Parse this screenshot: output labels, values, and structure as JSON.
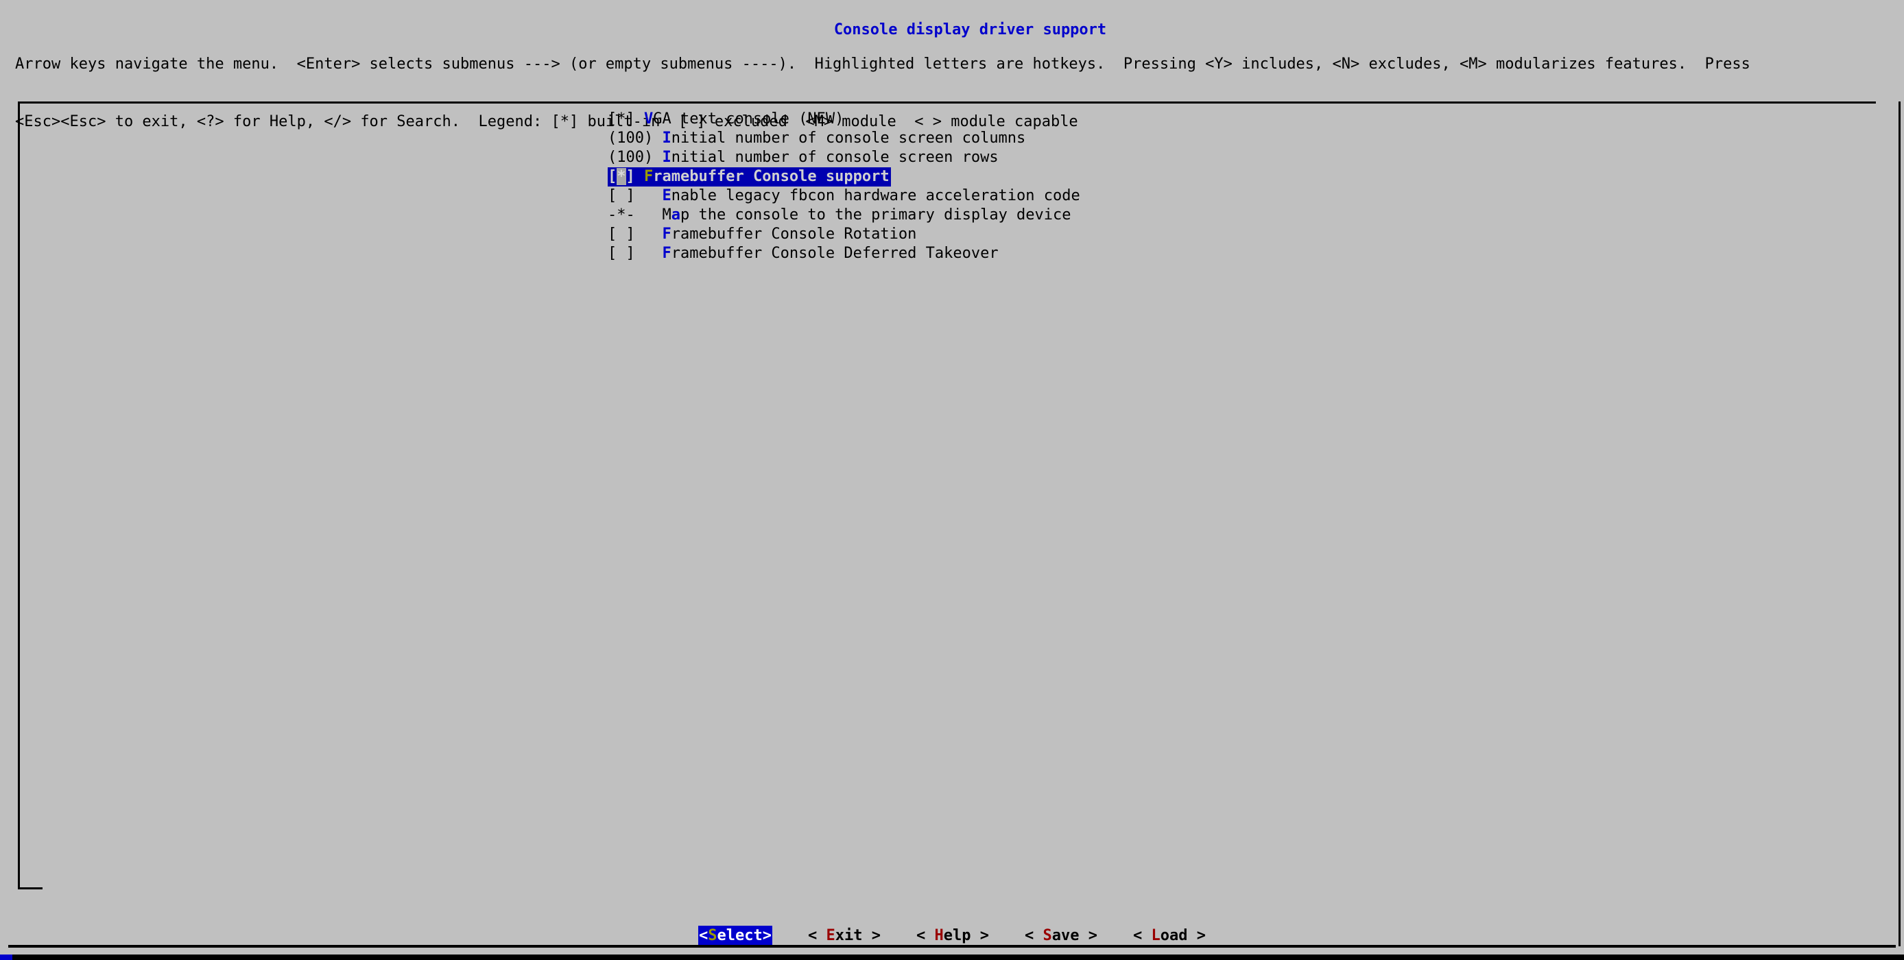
{
  "window": {
    "title": "Console display driver support"
  },
  "help": {
    "line1": "Arrow keys navigate the menu.  <Enter> selects submenus ---> (or empty submenus ----).  Highlighted letters are hotkeys.  Pressing <Y> includes, <N> excludes, <M> modularizes features.  Press",
    "line2": "<Esc><Esc> to exit, <?> for Help, </> for Search.  Legend: [*] built-in  [ ] excluded  <M> module  < > module capable"
  },
  "menu": {
    "items": [
      {
        "flag": "[*] ",
        "indent": "",
        "hotkey": "V",
        "label": "GA text console (NEW)",
        "selected": false
      },
      {
        "flag": "(100) ",
        "indent": "",
        "hotkey": "I",
        "label": "nitial number of console screen columns",
        "selected": false
      },
      {
        "flag": "(100) ",
        "indent": "",
        "hotkey": "I",
        "label": "nitial number of console screen rows",
        "selected": false
      },
      {
        "flag_pre": "[",
        "flag_cursor": "*",
        "flag_post": "] ",
        "flag": "[*] ",
        "indent": "",
        "hotkey": "F",
        "label": "ramebuffer Console support",
        "selected": true
      },
      {
        "flag": "[ ] ",
        "indent": "  ",
        "hotkey": "E",
        "label": "nable legacy fbcon hardware acceleration code",
        "selected": false
      },
      {
        "flag": "-*- ",
        "indent": "  ",
        "prefix": "M",
        "hotkey": "a",
        "label": "p the console to the primary display device",
        "selected": false
      },
      {
        "flag": "[ ] ",
        "indent": "  ",
        "hotkey": "F",
        "label": "ramebuffer Console Rotation",
        "selected": false
      },
      {
        "flag": "[ ] ",
        "indent": "  ",
        "hotkey": "F",
        "label": "ramebuffer Console Deferred Takeover",
        "selected": false
      }
    ]
  },
  "buttons": [
    {
      "open": "<",
      "hotkey": "S",
      "rest": "elect",
      "close": ">",
      "active": true
    },
    {
      "open": "< ",
      "hotkey": "E",
      "rest": "xit",
      "close": " >",
      "active": false
    },
    {
      "open": "< ",
      "hotkey": "H",
      "rest": "elp",
      "close": " >",
      "active": false
    },
    {
      "open": "< ",
      "hotkey": "S",
      "rest": "ave",
      "close": " >",
      "active": false
    },
    {
      "open": "< ",
      "hotkey": "L",
      "rest": "oad",
      "close": " >",
      "active": false
    }
  ],
  "colors": {
    "background": "#c0c0c0",
    "title": "#0000cc",
    "hotkey": "#0000cc",
    "selection_bg": "#0000b0",
    "selection_fg": "#d0d0d0",
    "selection_hotkey": "#9a9a00",
    "button_hotkey": "#990000",
    "frame": "#000000"
  }
}
